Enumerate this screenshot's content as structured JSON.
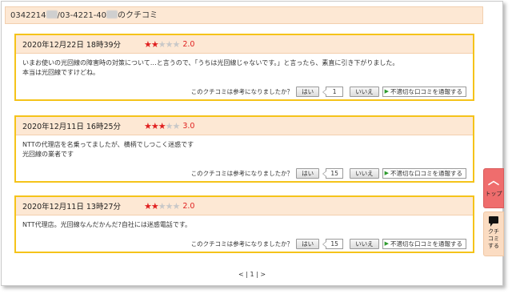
{
  "header": {
    "number_prefix": "0342214",
    "number_middle": "/03-4221-40",
    "suffix": "のクチコミ"
  },
  "reviews": [
    {
      "date": "2020年12月22日 18時39分",
      "stars_on": "★★",
      "stars_off": "★★★",
      "score": "2.0",
      "lines": [
        "いまお使いの光回線の障害時の対策について…と言うので、「うちは光回線じゃないです。」と言ったら、素直に引き下がりました。",
        "本当は光回線ですけどね。"
      ],
      "question": "このクチコミは参考になりましたか？",
      "yes_label": "はい",
      "count": "1",
      "no_label": "いいえ",
      "report_label": "不適切な口コミを通報する"
    },
    {
      "date": "2020年12月11日 16時25分",
      "stars_on": "★★★",
      "stars_off": "★★",
      "score": "3.0",
      "lines": [
        "NTTの代理店を名乗ってましたが、横柄でしつこく迷惑です",
        "光回線の業者です"
      ],
      "question": "このクチコミは参考になりましたか？",
      "yes_label": "はい",
      "count": "15",
      "no_label": "いいえ",
      "report_label": "不適切な口コミを通報する"
    },
    {
      "date": "2020年12月11日 13時27分",
      "stars_on": "★★",
      "stars_off": "★★★",
      "score": "2.0",
      "lines": [
        "NTT代理店。光回線なんだかんだ?自社には迷惑電話です。"
      ],
      "question": "このクチコミは参考になりましたか？",
      "yes_label": "はい",
      "count": "15",
      "no_label": "いいえ",
      "report_label": "不適切な口コミを通報する"
    }
  ],
  "pager": {
    "text": "< | 1 | >"
  },
  "side": {
    "top_label": "トップ",
    "kuchikomi_label_1": "クチ",
    "kuchikomi_label_2": "コミ",
    "kuchikomi_label_3": "する"
  },
  "icons": {
    "report_arrow": "arrow-right-icon",
    "top": "chevron-up-icon",
    "kuchikomi": "speech-bubble-icon"
  },
  "colors": {
    "accent_border": "#f5c31a",
    "header_bg": "#fde8d4",
    "star": "#e02020",
    "top_button": "#ef6d6d"
  }
}
